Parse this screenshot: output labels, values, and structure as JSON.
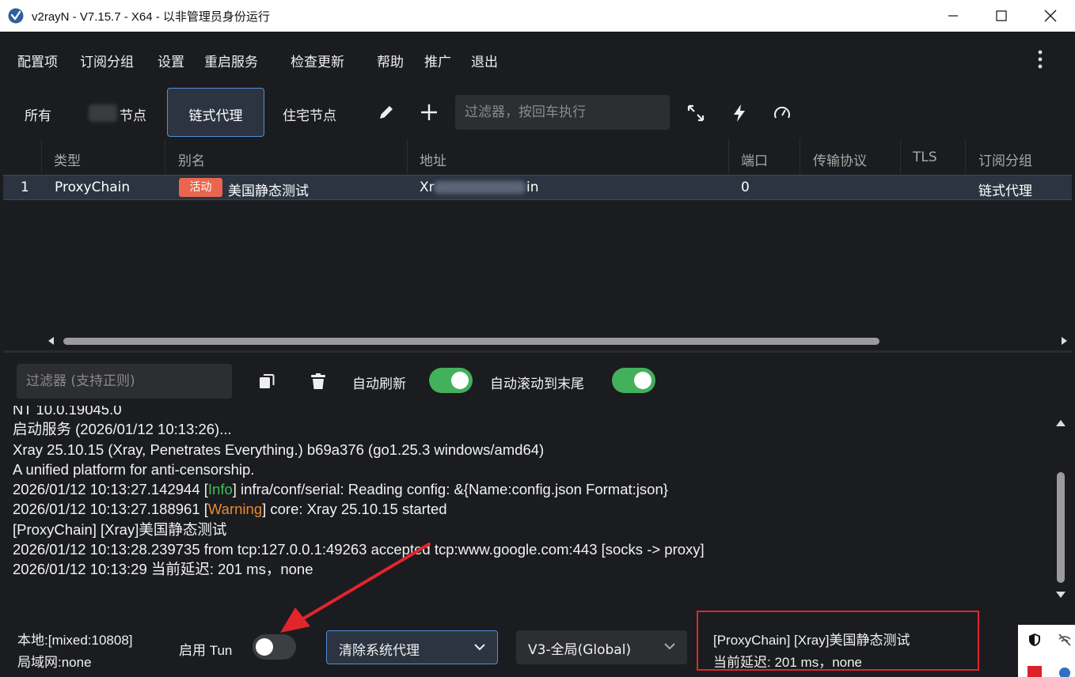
{
  "window": {
    "title": "v2rayN - V7.15.7 - X64 - 以非管理员身份运行"
  },
  "menu": [
    "配置项",
    "订阅分组",
    "设置",
    "重启服务",
    "检查更新",
    "帮助",
    "推广",
    "退出"
  ],
  "tabs": {
    "all": "所有",
    "nodes_suffix": "节点",
    "chain": "链式代理",
    "residential": "住宅节点",
    "filter_placeholder": "过滤器，按回车执行"
  },
  "table": {
    "headers": [
      "类型",
      "别名",
      "地址",
      "端口",
      "传输协议",
      "TLS",
      "订阅分组"
    ],
    "rows": [
      {
        "index": "1",
        "type": "ProxyChain",
        "badge": "活动",
        "alias": "美国静态测试",
        "address_start": "Xr",
        "address_end": "in",
        "port": "0",
        "transport": "",
        "tls": "",
        "group": "链式代理"
      }
    ]
  },
  "log_toolbar": {
    "filter_placeholder": "过滤器 (支持正则)",
    "auto_refresh_label": "自动刷新",
    "auto_refresh": true,
    "auto_scroll_label": "自动滚动到末尾",
    "auto_scroll": true
  },
  "log": {
    "line0": "NT 10.0.19045.0",
    "line1": "启动服务 (2026/01/12 10:13:26)...",
    "line2": "Xray 25.10.15 (Xray, Penetrates Everything.) b69a376 (go1.25.3 windows/amd64)",
    "line3": "A unified platform for anti-censorship.",
    "line4_pre": "2026/01/12 10:13:27.142944 [",
    "line4_level": "Info",
    "line4_post": "] infra/conf/serial: Reading config: &{Name:config.json Format:json}",
    "line5_pre": "2026/01/12 10:13:27.188961 [",
    "line5_level": "Warning",
    "line5_post": "] core: Xray 25.10.15 started",
    "line6": "[ProxyChain] [Xray]美国静态测试",
    "line7": "2026/01/12 10:13:28.239735 from tcp:127.0.0.1:49263 accepted tcp:www.google.com:443 [socks -> proxy]",
    "line8": "2026/01/12 10:13:29 当前延迟: 201 ms，none"
  },
  "status": {
    "local": "本地:[mixed:10808]",
    "lan": "局域网:none",
    "tun_label": "启用 Tun",
    "tun_enabled": false,
    "system_proxy": "清除系统代理",
    "routing": "V3-全局(Global)",
    "current_server": "[ProxyChain] [Xray]美国静态测试",
    "current_delay": "当前延迟: 201 ms，none"
  },
  "colors": {
    "accent": "#4f90d8",
    "toggle_on": "#43b05c",
    "badge": "#e8664f",
    "info": "#3fbd5a",
    "warning": "#e9892f",
    "highlight_box": "#e0262c"
  }
}
